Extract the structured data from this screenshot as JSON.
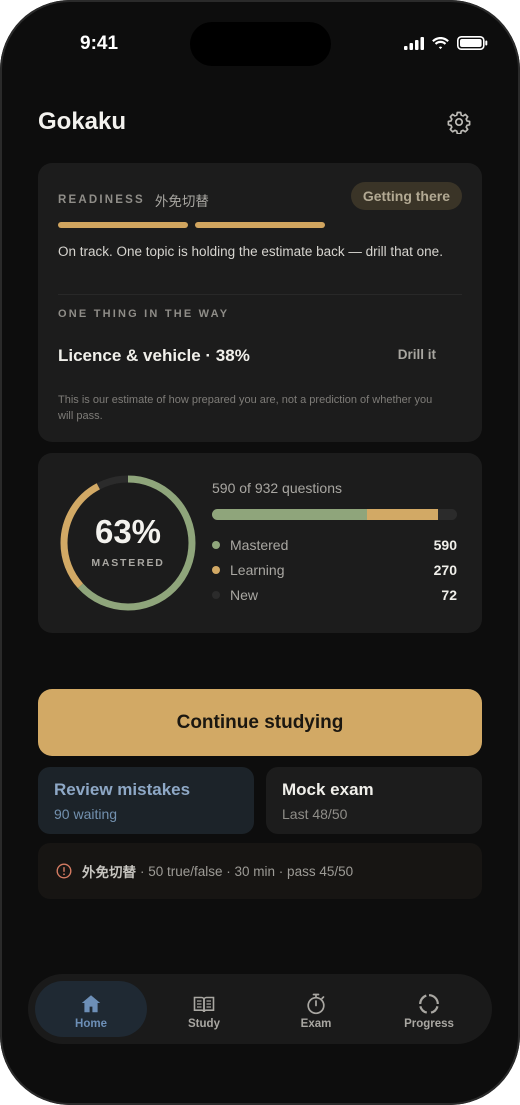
{
  "status_bar": {
    "time": "9:41"
  },
  "app": {
    "title": "Gokaku"
  },
  "readiness": {
    "label": "READINESS",
    "exam_name": "外免切替",
    "badge": "Getting there",
    "summary": "On track. One topic is holding the estimate back — drill that one.",
    "way_label": "ONE THING IN THE WAY",
    "topic": "Licence & vehicle · 38%",
    "drill_label": "Drill it",
    "disclaimer": "This is our estimate of how prepared you are, not a prediction of whether you will pass."
  },
  "progress": {
    "percent_text": "63%",
    "percent_label": "MASTERED",
    "question_summary": "590 of 932 questions",
    "total": 932,
    "legend": [
      {
        "name": "Mastered",
        "value": "590",
        "count": 590,
        "color": "#8fa57b"
      },
      {
        "name": "Learning",
        "value": "270",
        "count": 270,
        "color": "#d2a965"
      },
      {
        "name": "New",
        "value": "72",
        "count": 72,
        "color": "#2b2b2b"
      }
    ]
  },
  "actions": {
    "continue_label": "Continue studying",
    "review": {
      "title": "Review mistakes",
      "subtitle": "90 waiting"
    },
    "mock": {
      "title": "Mock exam",
      "subtitle": "Last 48/50"
    }
  },
  "exam_info": {
    "name": "外免切替",
    "details": "· 50 true/false · 30 min · pass 45/50"
  },
  "tabs": [
    {
      "label": "Home",
      "icon": "home-icon",
      "active": true
    },
    {
      "label": "Study",
      "icon": "book-icon",
      "active": false
    },
    {
      "label": "Exam",
      "icon": "stopwatch-icon",
      "active": false
    },
    {
      "label": "Progress",
      "icon": "progress-ring-icon",
      "active": false
    }
  ],
  "colors": {
    "accent": "#d2a965",
    "mastered": "#8fa57b",
    "active_tab": "#6d8fb7",
    "review_title": "#8ea8c6"
  }
}
